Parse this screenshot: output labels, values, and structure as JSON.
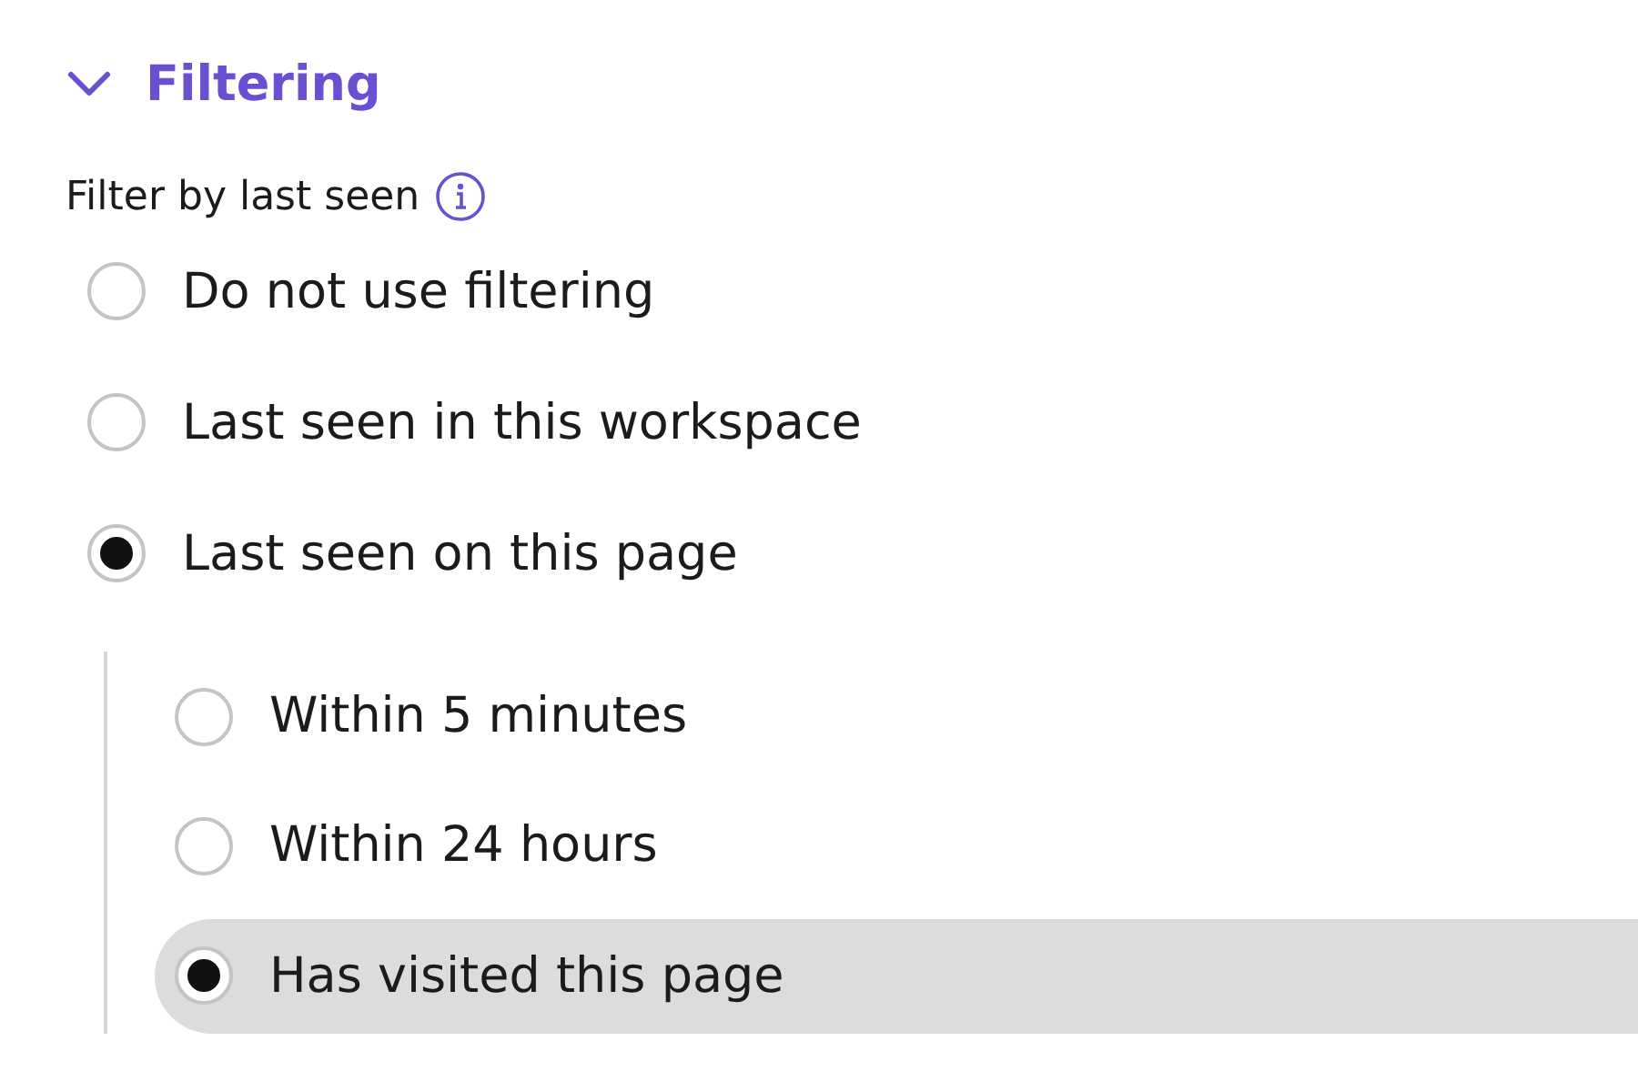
{
  "section": {
    "title": "Filtering",
    "expanded": true
  },
  "filter": {
    "label": "Filter by last seen",
    "options": [
      {
        "label": "Do not use filtering",
        "selected": false
      },
      {
        "label": "Last seen in this workspace",
        "selected": false
      },
      {
        "label": "Last seen on this page",
        "selected": true,
        "children": [
          {
            "label": "Within 5 minutes",
            "selected": false,
            "highlighted": false
          },
          {
            "label": "Within 24 hours",
            "selected": false,
            "highlighted": false
          },
          {
            "label": "Has visited this page",
            "selected": true,
            "highlighted": true
          }
        ]
      }
    ]
  }
}
